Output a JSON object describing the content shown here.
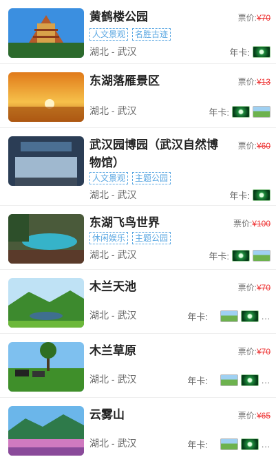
{
  "price_label": "票价:",
  "card_label": "年卡:",
  "items": [
    {
      "title": "黄鹤楼公园",
      "price": "¥70",
      "tags": [
        "人文景观",
        "名胜古迹"
      ],
      "location": "湖北 - 武汉",
      "card_icons": [
        "green-card-icon"
      ]
    },
    {
      "title": "东湖落雁景区",
      "price": "¥13",
      "tags": [],
      "location": "湖北 - 武汉",
      "card_icons": [
        "green-card-icon",
        "landscape-card-icon"
      ]
    },
    {
      "title": "武汉园博园（武汉自然博物馆）",
      "price": "¥60",
      "tags": [
        "人文景观",
        "主题公园"
      ],
      "location": "湖北 - 武汉",
      "card_icons": [
        "green-card-icon"
      ]
    },
    {
      "title": "东湖飞鸟世界",
      "price": "¥100",
      "tags": [
        "休闲娱乐",
        "主题公园"
      ],
      "location": "湖北 - 武汉",
      "card_icons": [
        "green-card-icon",
        "landscape-card-icon"
      ]
    },
    {
      "title": "木兰天池",
      "price": "¥70",
      "tags": [],
      "location": "湖北 - 武汉",
      "card_icons": [
        "landscape-card-icon",
        "green-card-icon"
      ],
      "more": "..."
    },
    {
      "title": "木兰草原",
      "price": "¥70",
      "tags": [],
      "location": "湖北 - 武汉",
      "card_icons": [
        "landscape-card-icon",
        "green-card-icon"
      ],
      "more": "..."
    },
    {
      "title": "云雾山",
      "price": "¥65",
      "tags": [],
      "location": "湖北 - 武汉",
      "card_icons": [
        "landscape-card-icon",
        "green-card-icon"
      ],
      "more": "..."
    }
  ]
}
